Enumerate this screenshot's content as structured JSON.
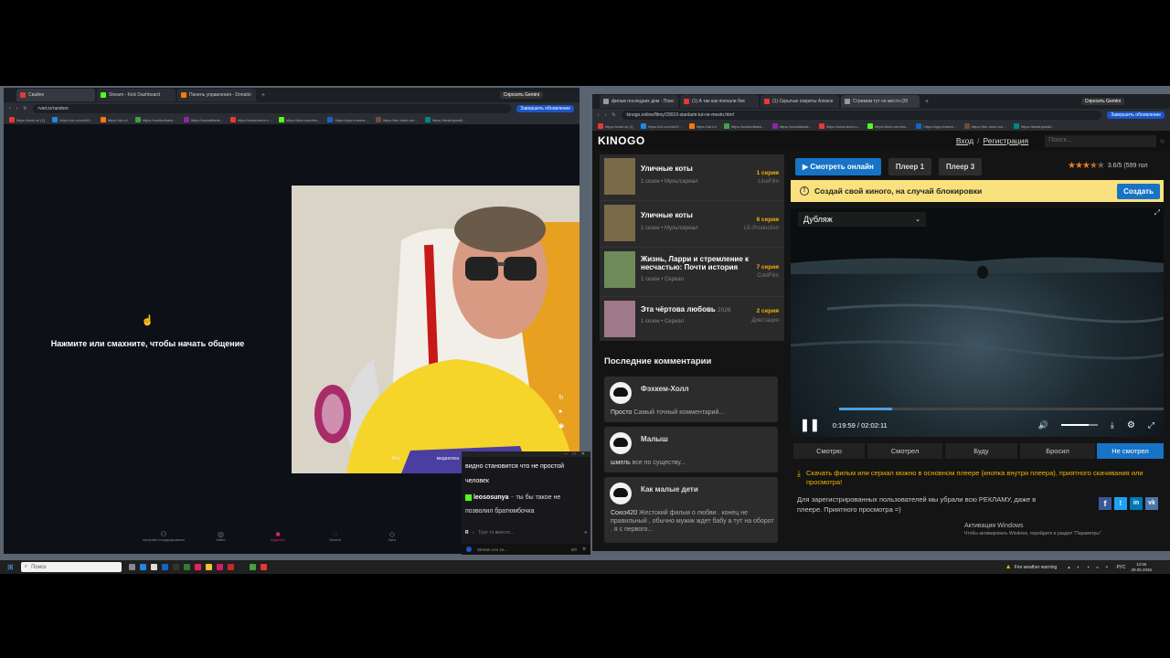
{
  "left_browser": {
    "tabs": [
      {
        "label": "Свайпе",
        "color": "#e53935"
      },
      {
        "label": "Stream - Kick Dashboard",
        "color": "#53fc18"
      },
      {
        "label": "Панель управления - Donatio",
        "color": "#f57c00"
      }
    ],
    "gemini_button": "Спросить Gemini",
    "url": "rviet.tv/random",
    "update_button": "Завершить обновление",
    "bookmarks": [
      "https://mail.ru/ (1)",
      "https://vk.com/id19...",
      "https://ok.ru/",
      "https://worldofbank...",
      "https://socialblade...",
      "https://www.tenor.c...",
      "https://kick.com/leo...",
      "https://app.remove...",
      "https://the-radio.ru/r...",
      "https://destinyandli..."
    ],
    "prompt_text": "Нажмите или смахните, чтобы начать общение",
    "bottom_nav": [
      {
        "label": "настройки и модерирование",
        "icon": "people-icon"
      },
      {
        "label": "Найти",
        "icon": "chat-icon"
      },
      {
        "label": "Видеочат",
        "icon": "video-icon"
      },
      {
        "label": "Личный",
        "icon": "lock-icon"
      },
      {
        "label": "Чаты",
        "icon": "message-icon"
      }
    ],
    "cam_overlay": [
      "Все",
      "медиатека"
    ]
  },
  "chat": {
    "messages": [
      {
        "user": "",
        "text": "видно становится что не простой человек"
      },
      {
        "user": "leososunya",
        "badge": "~",
        "text": "ты бы такое не позволил братюмбочка"
      }
    ],
    "input_placeholder": "Туре то вместе...",
    "footer": "Stream Leo 1e...",
    "footer_count": "0/0"
  },
  "right_browser": {
    "tabs": [
      {
        "label": "фильм последних дом - Поис",
        "color": "#999"
      },
      {
        "label": "(1) А так как поехали бис",
        "color": "#e53935"
      },
      {
        "label": "(1) Скрытые секреты Алексе",
        "color": "#e53935"
      },
      {
        "label": "Стримим тут не место (20",
        "color": "#999"
      }
    ],
    "gemini_button": "Спросить Gemini",
    "url": "kinogo.online/filmy/29010-stanlami-tut-ne-mesto.html",
    "update_button": "Завершить обновление",
    "bookmarks": [
      "https://mail.ru/ (1)",
      "https://vk.com/id19...",
      "https://ok.ru/",
      "https://worldofbank...",
      "https://socialblade...",
      "https://www.tenor.c...",
      "https://kick.com/leo...",
      "https://app.remove...",
      "https://the-radio.ru/r...",
      "https://destinyandli..."
    ]
  },
  "kinogo": {
    "logo": "KINOGO",
    "login": "Вход",
    "sep": "/",
    "register": "Регистрация",
    "search_placeholder": "Поиск...",
    "items": [
      {
        "title": "Уличные коты",
        "meta": "1 сезон • Мультсериал",
        "episode": "1 серия",
        "studio": "LineFilm",
        "color": "#7a6a48"
      },
      {
        "title": "Уличные коты",
        "meta": "1 сезон • Мультсериал",
        "episode": "6 серия",
        "studio": "LE-Production",
        "color": "#7a6a48"
      },
      {
        "title": "Жизнь, Ларри и стремление к несчастью: Почти история",
        "meta": "1 сезон • Сериал",
        "episode": "7 серия",
        "studio": "ColdFilm",
        "color": "#6d8a5a"
      },
      {
        "title": "Эта чёртова любовь",
        "year": "2026",
        "meta": "1 сезон • Сериал",
        "episode": "2 серия",
        "studio": "Дивстация",
        "color": "#a07a8a"
      }
    ],
    "comments_heading": "Последние комментарии",
    "comments": [
      {
        "name": "Фэхкем-Холл",
        "user": "Просто",
        "text": "Самый точный комментарий..."
      },
      {
        "name": "Малыш",
        "user": "шмель",
        "text": "все по существу..."
      },
      {
        "name": "Как малые дети",
        "user": "Союз420",
        "text": "Жестокий фильм о любви . конец не правильный , обычно мужик ждет бабу а тут на оборот . я с первого..."
      }
    ],
    "watch_button": "Смотреть онлайн",
    "player_tabs": [
      "Плеер 1",
      "Плеер 3"
    ],
    "rating": "3.6/5 (599 гол",
    "stars": 3.6,
    "banner_text": "Создай свой киного, на случай блокировки",
    "banner_button": "Создать",
    "dub_select": "Дубляж",
    "time_current": "0:19:59",
    "time_total": "02:02:11",
    "progress": 0.164,
    "volume": 0.75,
    "status_tabs": [
      "Смотрю",
      "Смотрел",
      "Буду",
      "Бросил",
      "Не смотрел"
    ],
    "status_active": "Не смотрел",
    "download_text": "Скачать фильм или сериал можно в основном плеере (кнопка внутри плеера), приятного скачивания или просмотра!",
    "ad_text": "Для зарегистрированных пользователей мы убрали всю РЕКЛАМУ, даже в плеере. Приятного просмотра =)",
    "activation_title": "Активация Windows",
    "activation_sub": "Чтобы активировать Windows, перейдите в раздел \"Параметры\"."
  },
  "taskbar": {
    "search_placeholder": "Поиск",
    "weather": "Fire weather warning",
    "lang": "РУС",
    "time": "12:55",
    "date": "29.05.2026"
  }
}
